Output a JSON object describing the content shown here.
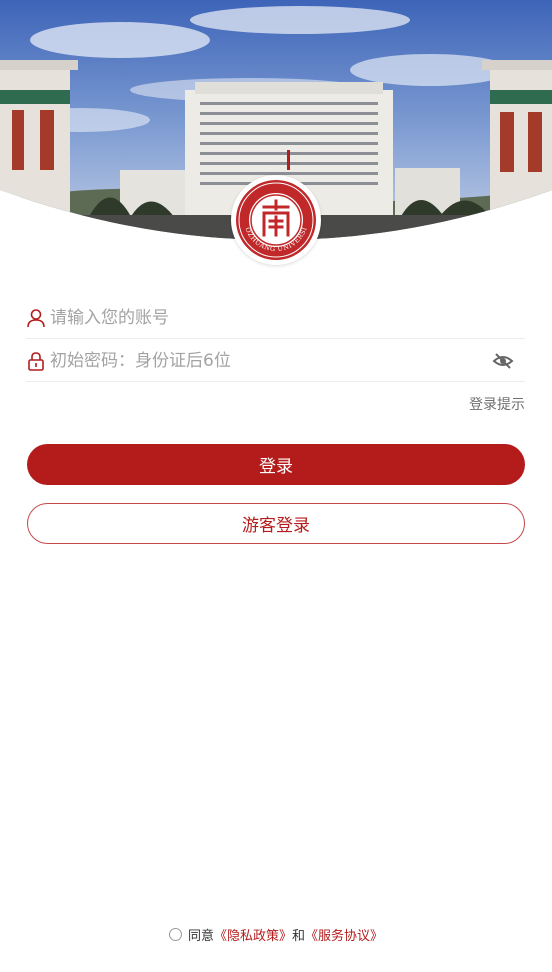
{
  "banner": {
    "seal_text": "ZAOZHUANG UNIVERSITY"
  },
  "form": {
    "account_placeholder": "请输入您的账号",
    "password_placeholder": "初始密码：身份证后6位",
    "hint_label": "登录提示"
  },
  "buttons": {
    "login_label": "登录",
    "guest_label": "游客登录"
  },
  "agreement": {
    "prefix": "同意",
    "privacy_link": "《隐私政策》",
    "and_text": "和",
    "service_link": "《服务协议》",
    "checked": false
  },
  "colors": {
    "brand_red": "#b41c1c",
    "placeholder_gray": "#a3a3a3"
  },
  "icons": {
    "account": "user-icon",
    "password": "lock-icon",
    "visibility": "eye-off-icon"
  }
}
